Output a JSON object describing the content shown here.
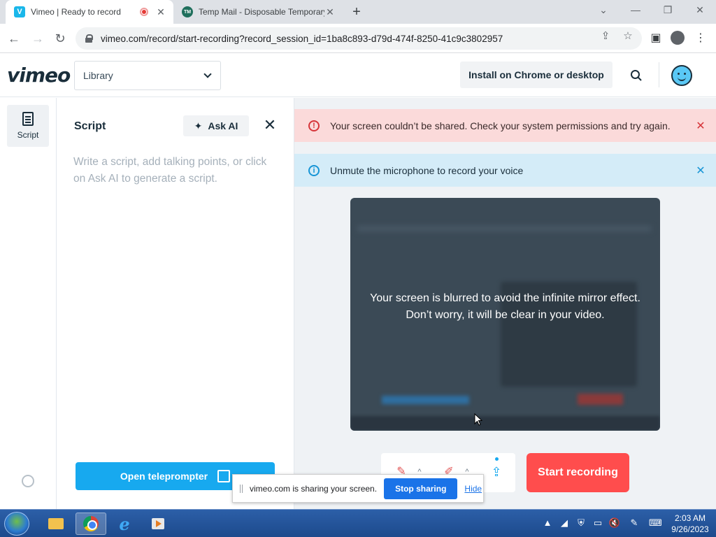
{
  "browser": {
    "tabs": [
      {
        "title": "Vimeo | Ready to record",
        "favicon": "V",
        "active": true,
        "recording": true
      },
      {
        "title": "Temp Mail - Disposable Temporary Email",
        "favicon": "TM",
        "active": false
      }
    ],
    "url": "vimeo.com/record/start-recording?record_session_id=1ba8c893-d79d-474f-8250-41c9c3802957"
  },
  "header": {
    "logo": "vimeo",
    "library_select": "Library",
    "install_label": "Install on Chrome or desktop"
  },
  "rail": {
    "items": [
      {
        "label": "Script"
      }
    ]
  },
  "script_panel": {
    "title": "Script",
    "ask_ai_label": "Ask AI",
    "placeholder": "Write a script, add talking points, or click on Ask AI to generate a script.",
    "teleprompter_label": "Open teleprompter"
  },
  "alerts": {
    "error": "Your screen couldn’t be shared. Check your system permissions and try again.",
    "info": "Unmute the microphone to record your voice"
  },
  "preview": {
    "line1": "Your screen is blurred to avoid the infinite mirror effect.",
    "line2": "Don’t worry, it will be clear in your video."
  },
  "controls": {
    "start_recording_label": "Start recording"
  },
  "share_bar": {
    "message": "vimeo.com is sharing your screen.",
    "stop_label": "Stop sharing",
    "hide_label": "Hide"
  },
  "taskbar": {
    "time": "2:03 AM",
    "date": "9/26/2023"
  },
  "colors": {
    "accent": "#17a9ef",
    "record": "#ff4d4d",
    "error_bg": "#fbdada",
    "info_bg": "#d4ecf8"
  }
}
